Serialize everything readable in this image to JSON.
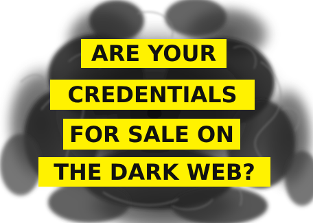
{
  "poster": {
    "headline_lines": [
      "ARE YOUR",
      "CREDENTIALS",
      "FOR SALE ON",
      "THE DARK WEB?"
    ],
    "colors": {
      "highlight": "#fff200",
      "text": "#111111",
      "smoke_dark": "#1a1a1a",
      "smoke_mid": "#5a5a5a",
      "background": "#ffffff"
    }
  }
}
